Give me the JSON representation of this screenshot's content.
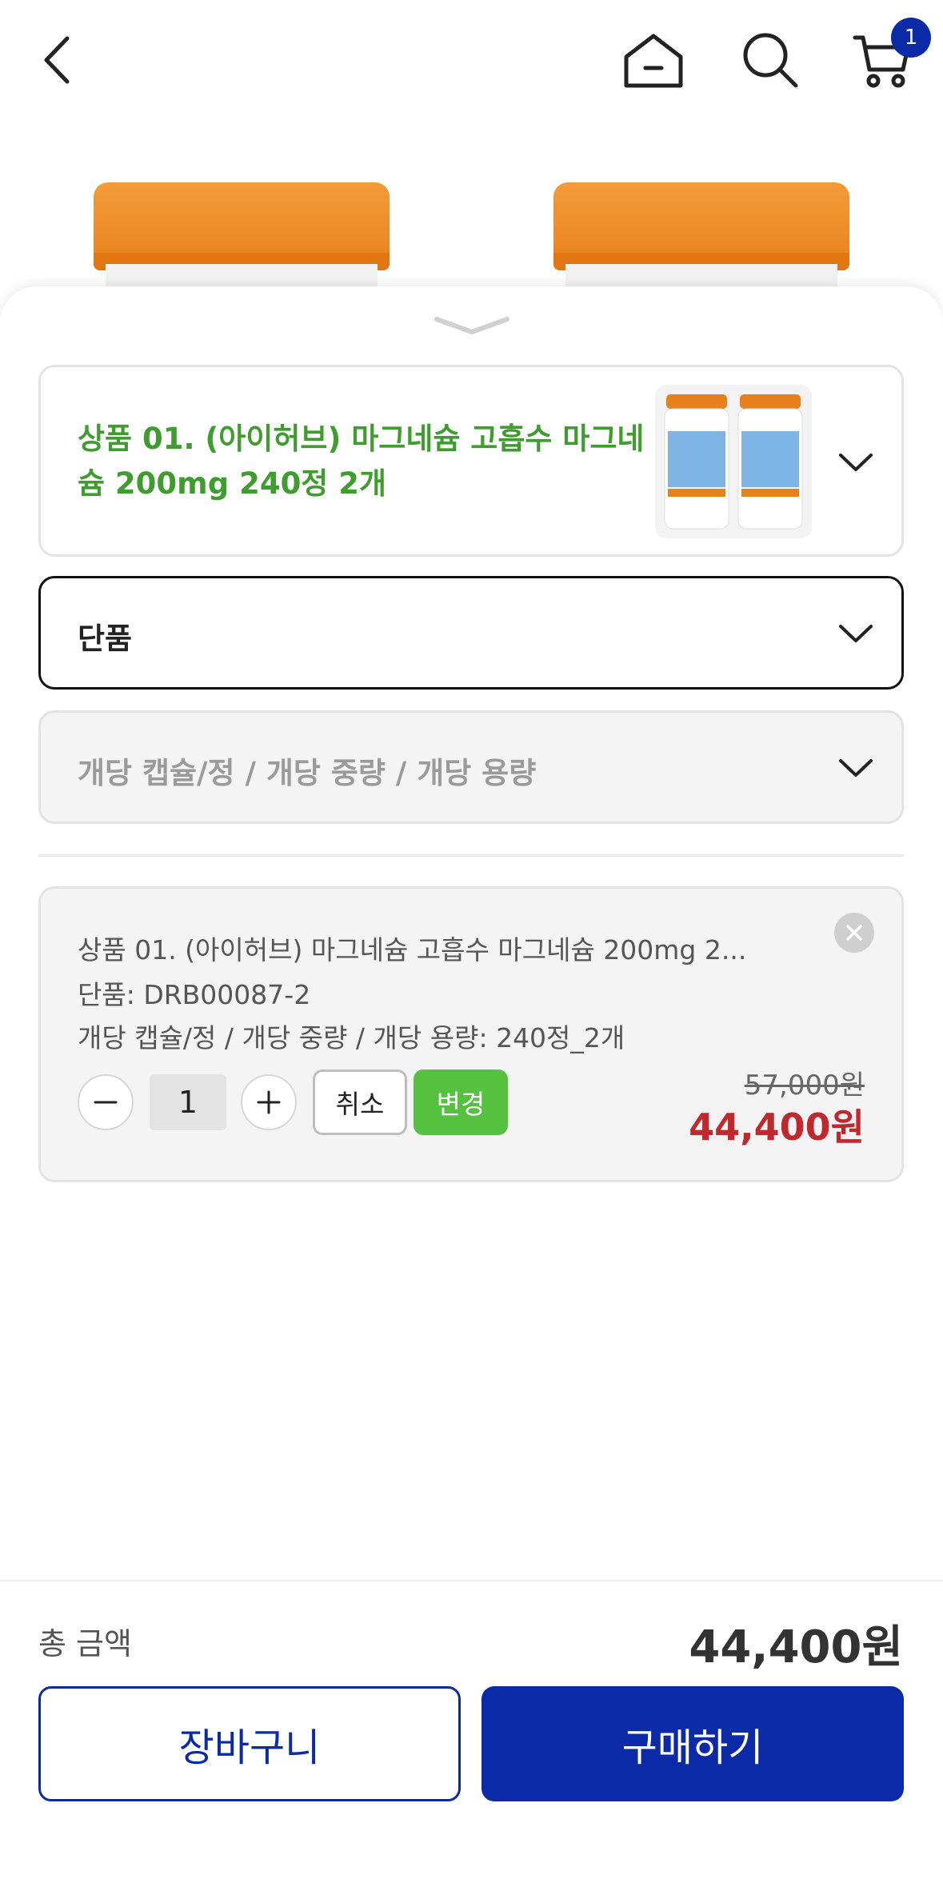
{
  "header": {
    "back_icon": "chevron-left-icon",
    "home_icon": "home-icon",
    "search_icon": "search-icon",
    "cart_icon": "cart-icon",
    "cart_count": "1"
  },
  "product_selector": {
    "title": "상품 01. (아이허브) 마그네슘 고흡수 마그네슘 200mg 240정 2개",
    "thumbnail_icon": "product-bottles-image"
  },
  "option1": {
    "value": "단품"
  },
  "option2": {
    "placeholder": "개당 캡슐/정 / 개당 중량 / 개당 용량"
  },
  "selected_item": {
    "name": "상품 01. (아이허브) 마그네슘 고흡수 마그네슘 200mg 2...",
    "option_line1": "단품: DRB00087-2",
    "option_line2": "개당 캡슐/정 / 개당 중량 / 개당 용량: 240정_2개",
    "quantity": "1",
    "cancel_label": "취소",
    "change_label": "변경",
    "original_price": "57,000원",
    "sale_price": "44,400원"
  },
  "footer": {
    "total_label": "총 금액",
    "total_value": "44,400원",
    "cart_button": "장바구니",
    "buy_button": "구매하기"
  },
  "colors": {
    "brand": "#0b2aa8",
    "product_title": "#3f9d2f",
    "change_button": "#55c13f",
    "sale_price": "#c0282d"
  }
}
